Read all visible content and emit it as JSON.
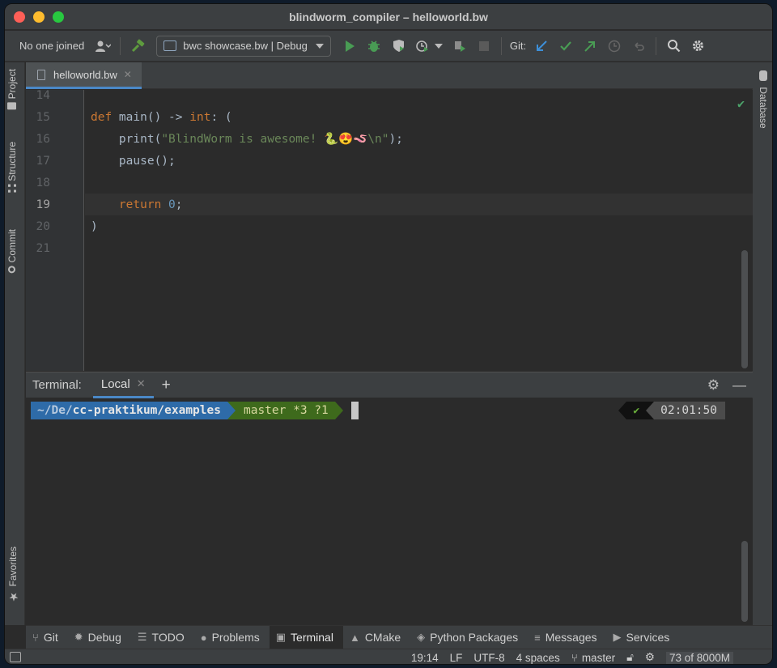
{
  "window": {
    "title": "blindworm_compiler – helloworld.bw"
  },
  "toolbar": {
    "collab_status": "No one joined",
    "run_config": "bwc showcase.bw | Debug",
    "git_label": "Git:"
  },
  "left_strip": {
    "items": [
      "Project",
      "Structure",
      "Commit",
      "Favorites"
    ]
  },
  "right_strip": {
    "items": [
      "Database"
    ]
  },
  "editor_tab": {
    "label": "helloworld.bw",
    "close": "✕"
  },
  "editor": {
    "lines": [
      {
        "num": "14",
        "text": ""
      },
      {
        "num": "15",
        "text": "def main() -> int: ("
      },
      {
        "num": "16",
        "text": "    print(\"BlindWorm is awesome! 🐍😍🪱\\n\");"
      },
      {
        "num": "17",
        "text": "    pause();"
      },
      {
        "num": "18",
        "text": ""
      },
      {
        "num": "19",
        "text": "    return 0;"
      },
      {
        "num": "20",
        "text": ")"
      },
      {
        "num": "21",
        "text": ""
      }
    ],
    "current_line": "19"
  },
  "terminal": {
    "title": "Terminal:",
    "tab": "Local",
    "tab_close": "✕",
    "add": "+",
    "path_dim": "~/De/",
    "path": "cc-praktikum/examples",
    "git_status": "master *3 ?1",
    "status_ok": "✔",
    "time": "02:01:50"
  },
  "tool_windows": [
    {
      "label": "Git",
      "icon": "git-branch-icon",
      "glyph": "⑂"
    },
    {
      "label": "Debug",
      "icon": "bug-icon",
      "glyph": "✹"
    },
    {
      "label": "TODO",
      "icon": "list-icon",
      "glyph": "☰"
    },
    {
      "label": "Problems",
      "icon": "warning-icon",
      "glyph": "●"
    },
    {
      "label": "Terminal",
      "icon": "terminal-icon",
      "glyph": "▣"
    },
    {
      "label": "CMake",
      "icon": "cmake-icon",
      "glyph": "▲"
    },
    {
      "label": "Python Packages",
      "icon": "layers-icon",
      "glyph": "◈"
    },
    {
      "label": "Messages",
      "icon": "messages-icon",
      "glyph": "≡"
    },
    {
      "label": "Services",
      "icon": "services-icon",
      "glyph": "▶"
    }
  ],
  "status_bar": {
    "position": "19:14",
    "line_sep": "LF",
    "encoding": "UTF-8",
    "indent": "4 spaces",
    "branch": "master",
    "memory": "73 of 8000M"
  },
  "colors": {
    "accent": "#4a88c7",
    "run_green": "#499c54",
    "path_segment": "#2e6ba8",
    "git_segment": "#3e6a1c"
  }
}
